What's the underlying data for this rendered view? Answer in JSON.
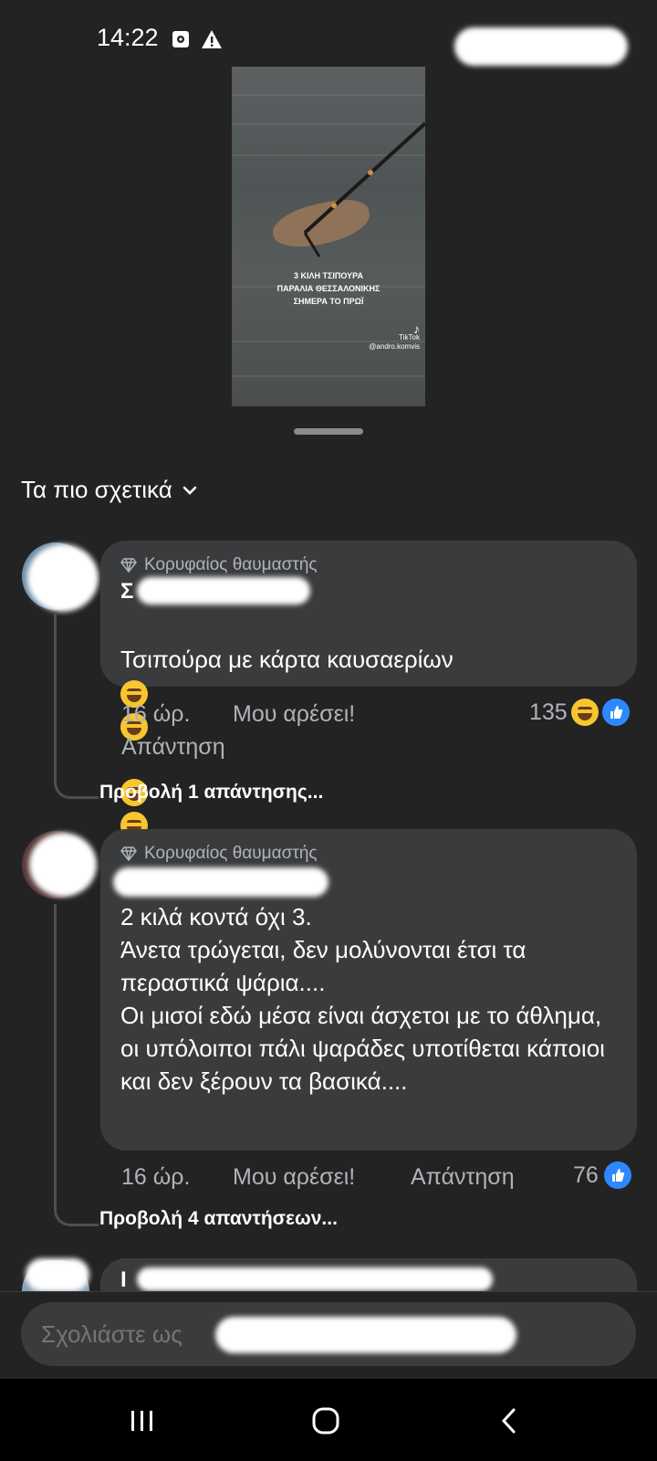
{
  "status_bar": {
    "time": "14:22"
  },
  "video": {
    "caption_lines": [
      "3 ΚΙΛΗ ΤΣΙΠΟΥΡΑ",
      "ΠΑΡΑΛΙΑ ΘΕΣΣΑΛΟΝΙΚΗΣ",
      "ΣΗΜΕΡΑ ΤΟ ΠΡΩΪ"
    ],
    "watermark": "TikTok",
    "handle": "@andro.komvis"
  },
  "sort": {
    "label": "Τα πιο σχετικά"
  },
  "comments": [
    {
      "badge": "Κορυφαίος θαυμαστής",
      "author": "Σ",
      "text": "Τσιπούρα με κάρτα καυσαερίων",
      "time": "16 ώρ.",
      "like_label": "Μου αρέσει!",
      "reply_label": "Απάντηση",
      "reaction_count": "135",
      "reactions": [
        "haha-icon",
        "like-icon"
      ],
      "view_replies": "Προβολή 1 απάντησης..."
    },
    {
      "badge": "Κορυφαίος θαυμαστής",
      "author": "",
      "text": "2 κιλά κοντά όχι 3.\nΆνετα τρώγεται, δεν μολύνονται έτσι τα περαστικά ψάρια....\nΟι μισοί εδώ μέσα είναι άσχετοι με το άθλημα, οι υπόλοιποι πάλι ψαράδες υποτίθεται κάποιοι και δεν ξέρουν τα βασικά....",
      "time": "16 ώρ.",
      "like_label": "Μου αρέσει!",
      "reply_label": "Απάντηση",
      "reaction_count": "76",
      "reactions": [
        "like-icon"
      ],
      "view_replies": "Προβολή 4 απαντήσεων..."
    },
    {
      "author": "Ι"
    }
  ],
  "composer": {
    "placeholder": "Σχολιάστε ως"
  },
  "colors": {
    "background": "#232324",
    "bubble": "#3a3b3c",
    "accent": "#2d88ff",
    "haha": "#f7c62f"
  }
}
